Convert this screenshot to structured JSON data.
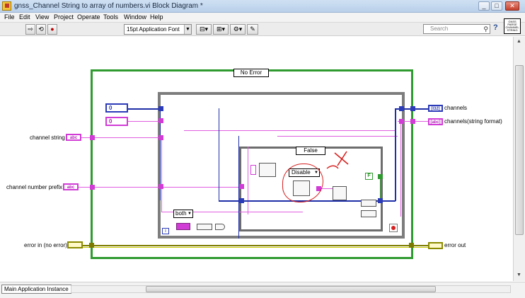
{
  "window": {
    "title": "gnss_Channel String to array of numbers.vi Block Diagram *",
    "buttons": {
      "minimize": "_",
      "maximize": "□",
      "close": "✕"
    }
  },
  "menu": [
    "File",
    "Edit",
    "View",
    "Project",
    "Operate",
    "Tools",
    "Window",
    "Help"
  ],
  "toolbar": {
    "font_select": "15pt Application Font",
    "search_placeholder": "Search",
    "help": "?"
  },
  "vi_icon_text": [
    "GNSS",
    "PARSE",
    "CHANNEL",
    "STRING"
  ],
  "diagram": {
    "case_outer": "No Error",
    "case_inner": "False",
    "ring_value": "Disable",
    "mode_value": "both",
    "loop_index": "i",
    "constant_0a": "0",
    "constant_0b": "0",
    "bool_const": "F",
    "inputs": [
      {
        "label": "channel string",
        "terminal": "abc"
      },
      {
        "label": "channel number prefix",
        "terminal": "abc"
      },
      {
        "label": "error in (no error)",
        "terminal": ""
      }
    ],
    "outputs": [
      {
        "label": "channels",
        "terminal": "[I32]"
      },
      {
        "label": "channels(string format)",
        "terminal": "[abc]"
      },
      {
        "label": "error out",
        "terminal": ""
      }
    ]
  },
  "status": {
    "instance": "Main Application Instance"
  },
  "colors": {
    "string_wire": "#e05ee0",
    "numeric_wire": "#1f2fa8",
    "error_wire": "#7a7a00",
    "case_frame": "#2f9a2f",
    "annotation": "#d62020"
  }
}
